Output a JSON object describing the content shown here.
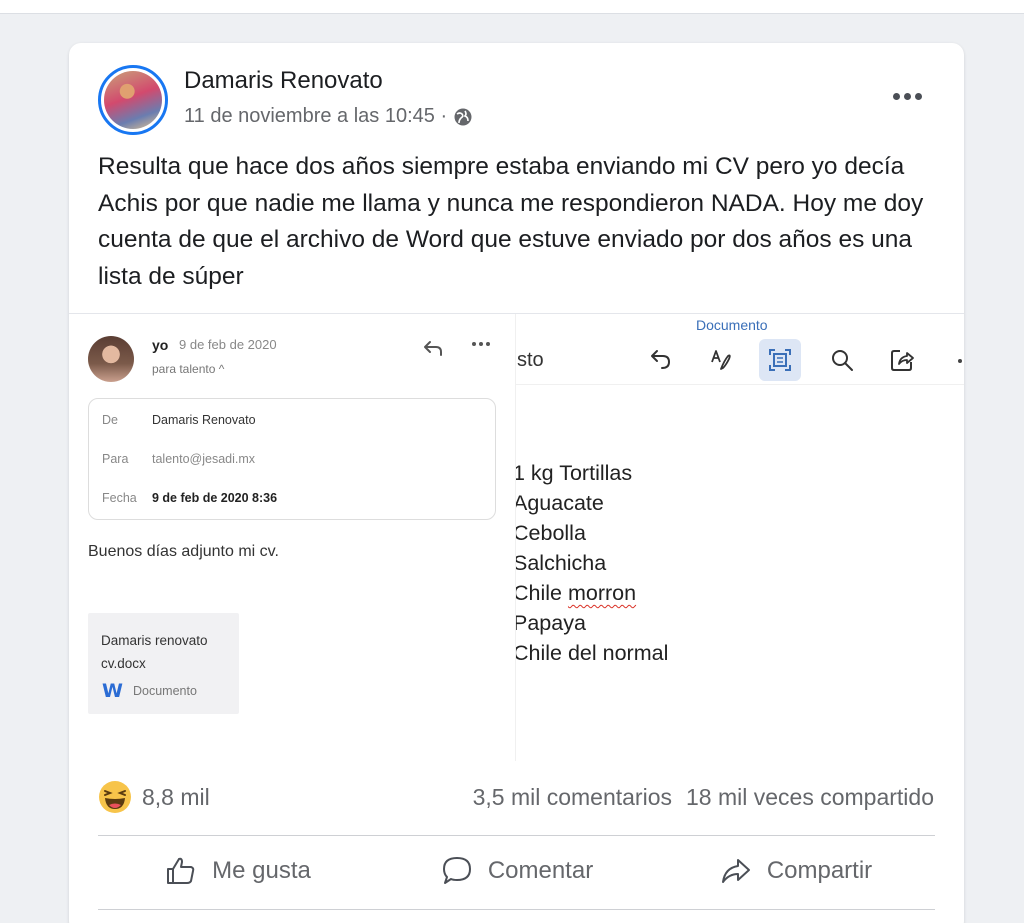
{
  "post": {
    "author": "Damaris Renovato",
    "timestamp": "11 de noviembre a las 10:45 ·",
    "privacy_icon": "globe-icon",
    "text": "Resulta que hace dos años siempre estaba enviando mi CV pero yo decía Achis por que nadie me llama y nunca me respondieron NADA. Hoy me doy cuenta de que el archivo de Word que estuve enviado por dos años es una lista de súper"
  },
  "email": {
    "sender": "yo",
    "date": "9 de feb de 2020",
    "to_line": "para talento ^",
    "details": {
      "from_label": "De",
      "from_value": "Damaris Renovato",
      "to_label": "Para",
      "to_value": "talento@jesadi.mx",
      "date_label": "Fecha",
      "date_value": "9 de feb de 2020 8:36"
    },
    "body": "Buenos días adjunto mi cv.",
    "attachment": {
      "name": "Damaris renovato cv.docx",
      "icon": "W",
      "type": "Documento"
    }
  },
  "document": {
    "title": "Documento",
    "left_label": "sto",
    "toolbar": [
      "undo-icon",
      "draw-icon",
      "focus-icon",
      "search-icon",
      "share-icon"
    ],
    "items": [
      "1 kg Tortillas",
      "Aguacate",
      "Cebolla",
      "Salchicha",
      "Chile ",
      "morron",
      "Papaya",
      "Chile del normal"
    ]
  },
  "engagement": {
    "reaction_emoji": "laughing-emoji",
    "reaction_count": "8,8 mil",
    "comments": "3,5 mil comentarios",
    "shares": "18 mil veces compartido"
  },
  "actions": {
    "like": "Me gusta",
    "comment": "Comentar",
    "share": "Compartir"
  },
  "colors": {
    "accent": "#1877f2",
    "secondary_text": "#65676b",
    "background": "#eef0f3"
  }
}
